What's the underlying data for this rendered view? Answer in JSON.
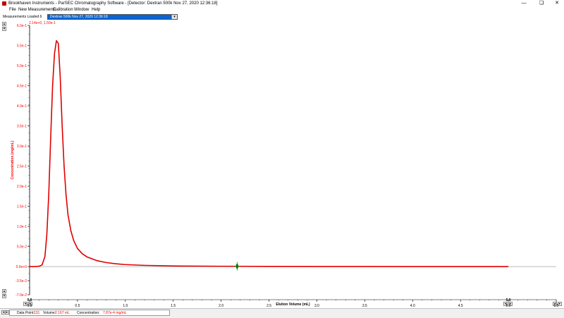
{
  "window": {
    "title": "Brookhaven Instruments - ParSEC Chromatography Software - [Detector: Dextran 500k   Nov 27, 2020   12:36:18]",
    "minimize": "—",
    "restore": "❏",
    "close": "✕"
  },
  "menu": [
    "File",
    "New Measurements",
    "Calibration",
    "Window",
    "Help"
  ],
  "toolbar": {
    "measurements_label": "Measurements Loaded 6",
    "selected_measurement": "Dextran 500k   Nov 27, 2020   12:36:18"
  },
  "cursor_readout": "2.14e+0, 1.50e-1",
  "status": {
    "data_point_label": "Data Point:",
    "data_point_value": "131",
    "volume_label": "Volume:",
    "volume_value": "2.167 mL",
    "concentration_label": "Concentration:",
    "concentration_value": "7.87e-4 mg/mL"
  },
  "colors": {
    "curve": "#e00000",
    "axis_text": "#ff0000",
    "marker": "#008000",
    "selection": "#0a64d2"
  },
  "icons": {
    "scroll_up": "▴",
    "scroll_down": "▾",
    "scroll_left": "◂",
    "scroll_right": "▸"
  },
  "chart_data": {
    "type": "line",
    "xlabel": "Elution Volume (mL)",
    "ylabel": "Concentration (mg/mL)",
    "xlim": [
      0.0,
      5.5
    ],
    "ylim": [
      -0.07,
      0.6
    ],
    "x_ticks": [
      "0.0",
      "0.5",
      "1.0",
      "1.5",
      "2.0",
      "2.5",
      "3.0",
      "3.5",
      "4.0",
      "4.5",
      "5.0",
      "5.5"
    ],
    "y_ticks": [
      "-7.0e-2",
      "-3.5e-2",
      "0.0e+0",
      "5.0e-2",
      "1.0e-1",
      "1.5e-1",
      "2.0e-1",
      "2.5e-1",
      "3.0e-1",
      "3.5e-1",
      "4.0e-1",
      "4.5e-1",
      "5.0e-1",
      "5.5e-1",
      "6.0e-1"
    ],
    "x_range_labels": {
      "start": "0.0",
      "end": "5.0"
    },
    "series": [
      {
        "x": [
          0.0,
          0.05,
          0.1,
          0.13,
          0.16,
          0.18,
          0.2,
          0.22,
          0.24,
          0.26,
          0.28,
          0.3,
          0.32,
          0.34,
          0.36,
          0.38,
          0.4,
          0.43,
          0.46,
          0.5,
          0.55,
          0.6,
          0.7,
          0.8,
          0.9,
          1.0,
          1.2,
          1.5,
          2.0,
          2.5,
          3.0,
          3.5,
          4.0,
          4.5,
          5.0
        ],
        "y": [
          0.0,
          0.0,
          0.001,
          0.004,
          0.025,
          0.08,
          0.18,
          0.32,
          0.45,
          0.53,
          0.562,
          0.555,
          0.47,
          0.35,
          0.25,
          0.18,
          0.13,
          0.09,
          0.065,
          0.045,
          0.032,
          0.024,
          0.015,
          0.01,
          0.007,
          0.005,
          0.003,
          0.0015,
          0.0008,
          0.0005,
          0.0003,
          0.0002,
          0.0001,
          0.0001,
          0.0
        ]
      }
    ],
    "marker": {
      "x": 2.167,
      "y": 0.000787
    }
  }
}
